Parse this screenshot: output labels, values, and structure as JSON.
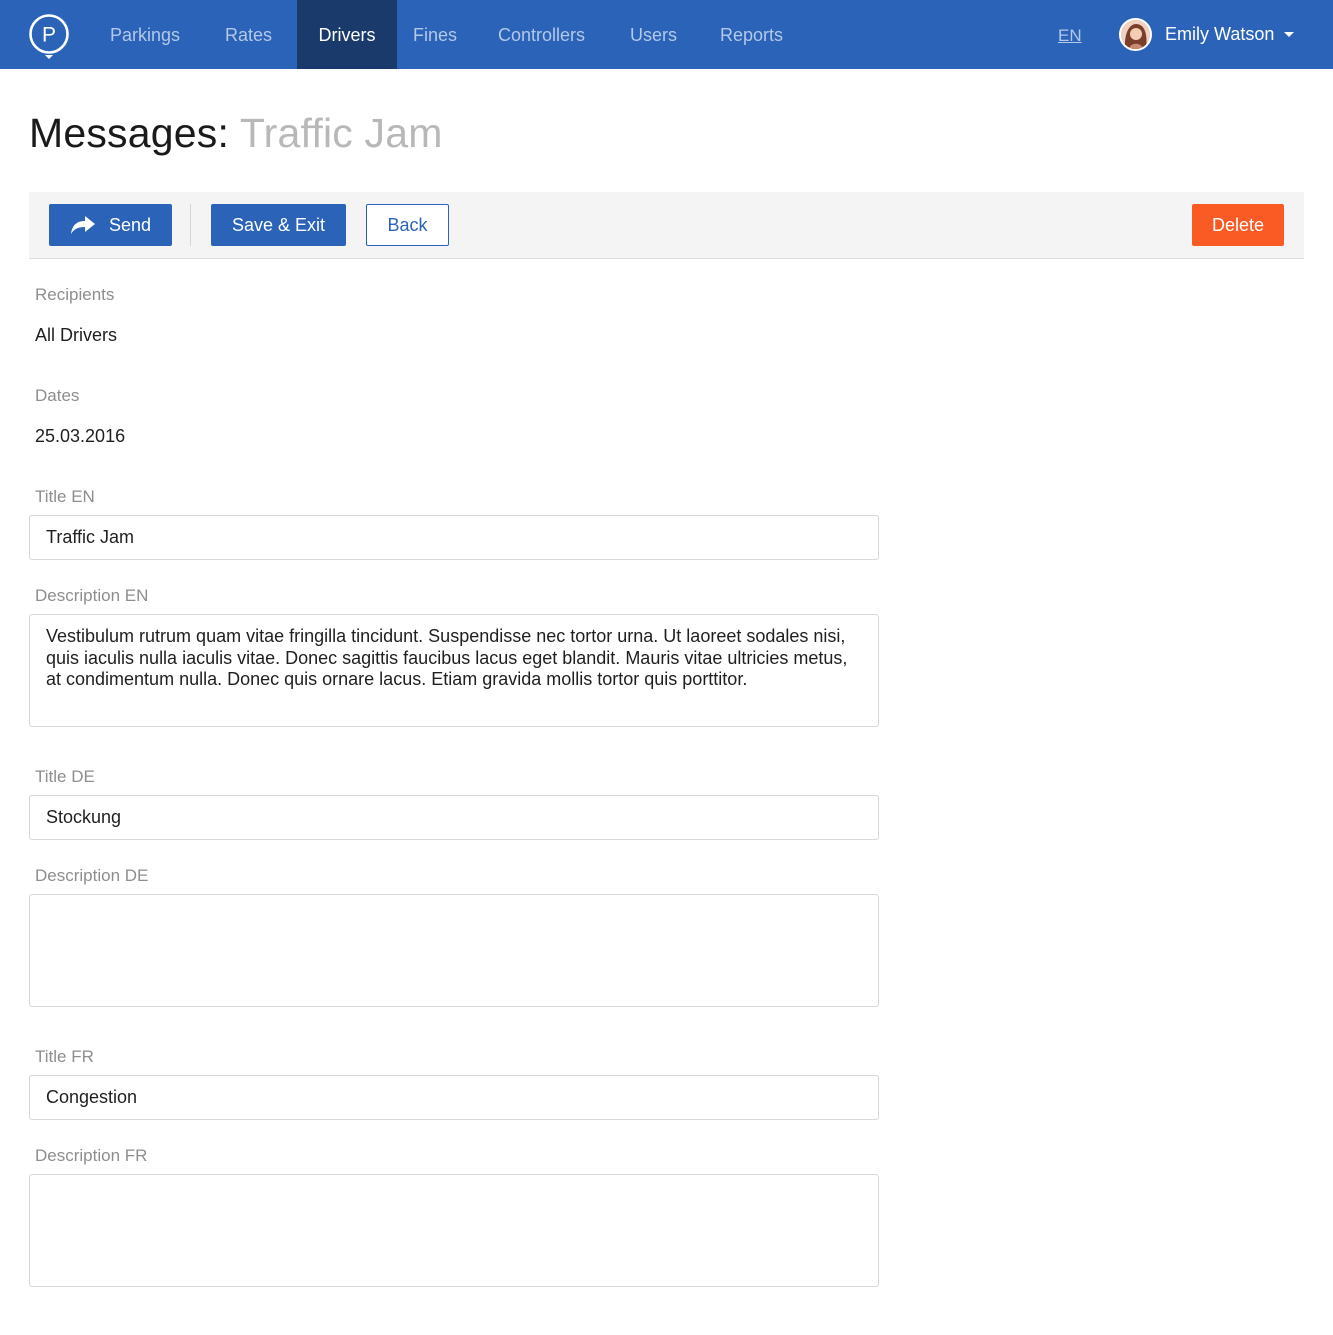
{
  "nav": {
    "items": [
      {
        "label": "Parkings"
      },
      {
        "label": "Rates"
      },
      {
        "label": "Drivers",
        "active": true
      },
      {
        "label": "Fines"
      },
      {
        "label": "Controllers"
      },
      {
        "label": "Users"
      },
      {
        "label": "Reports"
      }
    ],
    "language": "EN",
    "user_name": "Emily Watson",
    "logo_icon": "parking-logo-icon"
  },
  "page": {
    "title": "Messages:",
    "subtitle": "Traffic Jam"
  },
  "toolbar": {
    "send_label": "Send",
    "send_icon": "share-arrow-icon",
    "save_label": "Save & Exit",
    "back_label": "Back",
    "delete_label": "Delete"
  },
  "form": {
    "recipients_label": "Recipients",
    "recipients_value": "All Drivers",
    "dates_label": "Dates",
    "dates_value": "25.03.2016",
    "title_en_label": "Title EN",
    "title_en_value": "Traffic Jam",
    "description_en_label": "Description EN",
    "description_en_value": "Vestibulum rutrum quam vitae fringilla tincidunt. Suspendisse nec tortor urna. Ut laoreet sodales nisi, quis iaculis nulla iaculis vitae. Donec sagittis faucibus lacus eget blandit. Mauris vitae ultricies metus, at condimentum nulla. Donec quis ornare lacus. Etiam gravida mollis tortor quis porttitor.",
    "title_de_label": "Title DE",
    "title_de_value": "Stockung",
    "description_de_label": "Description DE",
    "description_de_value": "",
    "title_fr_label": "Title FR",
    "title_fr_value": "Congestion",
    "description_fr_label": "Description FR",
    "description_fr_value": ""
  },
  "colors": {
    "brand": "#2a63b8",
    "nav_active": "#1a3a6b",
    "danger": "#fa5a23"
  }
}
